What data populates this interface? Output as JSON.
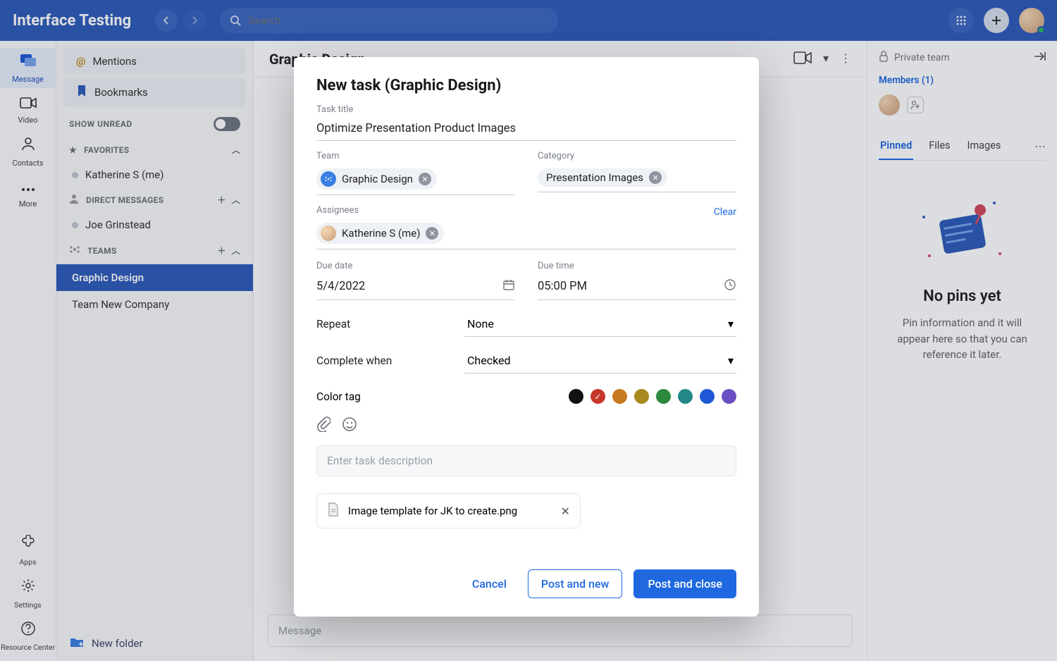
{
  "brand": "Interface Testing",
  "search_placeholder": "Search",
  "rail": {
    "message": "Message",
    "video": "Video",
    "contacts": "Contacts",
    "more": "More",
    "apps": "Apps",
    "settings": "Settings",
    "resource_center": "Resource Center"
  },
  "conv": {
    "mentions": "Mentions",
    "bookmarks": "Bookmarks",
    "show_unread": "SHOW UNREAD",
    "favorites": "FAVORITES",
    "direct_messages": "DIRECT MESSAGES",
    "teams": "TEAMS",
    "me": "Katherine S (me)",
    "dm1": "Joe Grinstead",
    "team_active": "Graphic Design",
    "team_other": "Team New Company",
    "new_folder": "New folder"
  },
  "main": {
    "title": "Graphic Design",
    "msg_placeholder": "Message"
  },
  "details": {
    "private": "Private team",
    "members": "Members (1)",
    "tabs": {
      "pinned": "Pinned",
      "files": "Files",
      "images": "Images"
    },
    "nopins_title": "No pins yet",
    "nopins_body": "Pin information and it will appear here so that you can reference it later."
  },
  "modal": {
    "title": "New task (Graphic Design)",
    "labels": {
      "task_title": "Task title",
      "team": "Team",
      "category": "Category",
      "assignees": "Assignees",
      "clear": "Clear",
      "due_date": "Due date",
      "due_time": "Due time",
      "repeat": "Repeat",
      "complete_when": "Complete when",
      "color_tag": "Color tag"
    },
    "values": {
      "task_title": "Optimize Presentation Product Images",
      "team_chip": "Graphic Design",
      "category_chip": "Presentation Images",
      "assignee_chip": "Katherine S (me)",
      "due_date": "5/4/2022",
      "due_time": "05:00 PM",
      "repeat": "None",
      "complete_when": "Checked",
      "desc_placeholder": "Enter task description",
      "attachment": "Image template for JK to create.png"
    },
    "colors": [
      "#111111",
      "#c6362b",
      "#c67a1f",
      "#a78a1f",
      "#2c8a3d",
      "#238787",
      "#1f57d6",
      "#6a4fc2"
    ],
    "selected_color_index": 1,
    "buttons": {
      "cancel": "Cancel",
      "post_new": "Post and new",
      "post_close": "Post and close"
    }
  }
}
